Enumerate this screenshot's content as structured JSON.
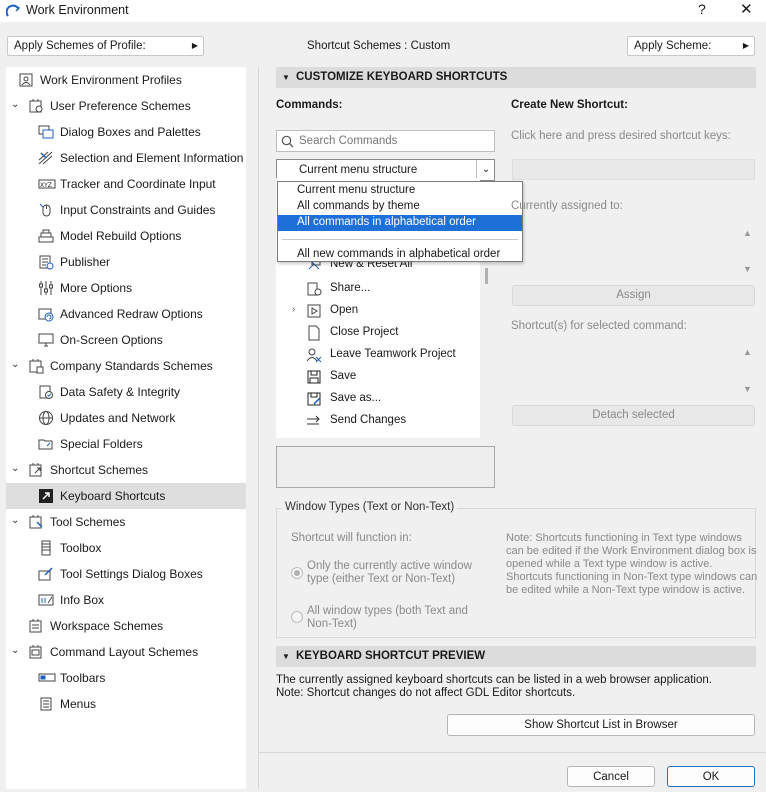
{
  "window": {
    "title": "Work Environment",
    "help_glyph": "?",
    "close_glyph": "✕"
  },
  "topbar": {
    "apply_profile_label": "Apply Schemes of Profile:",
    "shortcut_schemes_label": "Shortcut Schemes :",
    "shortcut_schemes_value": "Custom",
    "apply_scheme_label": "Apply Scheme:"
  },
  "tree": {
    "items": [
      {
        "label": "Work Environment Profiles",
        "icon": "profiles-icon"
      },
      {
        "label": "User Preference Schemes",
        "icon": "user-preferences-icon"
      },
      {
        "label": "Dialog Boxes and Palettes",
        "icon": "dialog-boxes-icon"
      },
      {
        "label": "Selection and Element Information",
        "icon": "selection-icon"
      },
      {
        "label": "Tracker and Coordinate Input",
        "icon": "tracker-icon"
      },
      {
        "label": "Input Constraints and Guides",
        "icon": "mouse-icon"
      },
      {
        "label": "Model Rebuild Options",
        "icon": "rebuild-icon"
      },
      {
        "label": "Publisher",
        "icon": "publisher-icon"
      },
      {
        "label": "More Options",
        "icon": "sliders-icon"
      },
      {
        "label": "Advanced Redraw Options",
        "icon": "redraw-icon"
      },
      {
        "label": "On-Screen Options",
        "icon": "monitor-icon"
      },
      {
        "label": "Company Standards Schemes",
        "icon": "company-standards-icon"
      },
      {
        "label": "Data Safety & Integrity",
        "icon": "data-safety-icon"
      },
      {
        "label": "Updates and Network",
        "icon": "globe-icon"
      },
      {
        "label": "Special Folders",
        "icon": "folder-icon"
      },
      {
        "label": "Shortcut Schemes",
        "icon": "shortcut-schemes-icon"
      },
      {
        "label": "Keyboard Shortcuts",
        "icon": "keyboard-shortcut-icon"
      },
      {
        "label": "Tool Schemes",
        "icon": "tool-schemes-icon"
      },
      {
        "label": "Toolbox",
        "icon": "toolbox-icon"
      },
      {
        "label": "Tool Settings Dialog Boxes",
        "icon": "tool-settings-icon"
      },
      {
        "label": "Info Box",
        "icon": "info-box-icon"
      },
      {
        "label": "Workspace Schemes",
        "icon": "workspace-icon"
      },
      {
        "label": "Command Layout Schemes",
        "icon": "command-layout-icon"
      },
      {
        "label": "Toolbars",
        "icon": "toolbars-icon"
      },
      {
        "label": "Menus",
        "icon": "menus-icon"
      }
    ],
    "selected": "Keyboard Shortcuts"
  },
  "customize": {
    "header": "CUSTOMIZE KEYBOARD SHORTCUTS",
    "commands_label": "Commands:",
    "search_placeholder": "Search Commands",
    "structure_select_value": "Current menu structure",
    "structure_options": [
      "Current menu structure",
      "All commands by theme",
      "All commands in alphabetical order",
      "All new commands in alphabetical order"
    ],
    "highlighted_option": "All commands in alphabetical order",
    "commands": [
      {
        "label": "New & Reset All",
        "icon": "new-reset-icon"
      },
      {
        "label": "Share...",
        "icon": "share-icon"
      },
      {
        "label": "Open",
        "icon": "open-icon",
        "expandable": true
      },
      {
        "label": "Close Project",
        "icon": "close-project-icon"
      },
      {
        "label": "Leave Teamwork Project",
        "icon": "leave-teamwork-icon"
      },
      {
        "label": "Save",
        "icon": "save-icon"
      },
      {
        "label": "Save as...",
        "icon": "save-as-icon"
      },
      {
        "label": "Send Changes",
        "icon": "send-changes-icon"
      }
    ],
    "create_new_label": "Create New Shortcut:",
    "create_hint": "Click here and press desired shortcut keys:",
    "assigned_to_label": "Currently assigned to:",
    "assign_button": "Assign",
    "shortcuts_selected_label": "Shortcut(s) for selected command:",
    "detach_button": "Detach selected"
  },
  "window_types": {
    "legend": "Window Types (Text or Non-Text)",
    "function_label": "Shortcut will function in:",
    "option1": "Only the currently active window type (either Text or Non-Text)",
    "option2": "All window types (both Text and Non-Text)",
    "note": "Note: Shortcuts functioning in Text type windows can be edited if the Work Environment dialog box is opened while a Text type window is active. Shortcuts functioning in Non-Text type windows can be edited while a Non-Text type window is active."
  },
  "preview": {
    "header": "KEYBOARD SHORTCUT PREVIEW",
    "line1": "The currently assigned keyboard shortcuts can be listed in a web browser application.",
    "line2": "Note: Shortcut changes do not affect GDL Editor shortcuts.",
    "show_button": "Show Shortcut List in Browser"
  },
  "footer": {
    "cancel": "Cancel",
    "ok": "OK"
  },
  "colors": {
    "accent": "#1e6fd8",
    "selected_tree_bg": "#dedede",
    "section_header_bg": "#dcdcdc"
  }
}
